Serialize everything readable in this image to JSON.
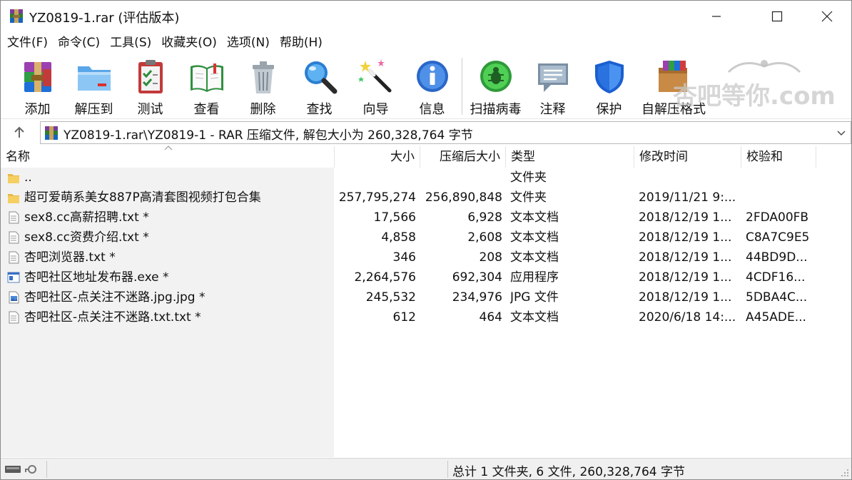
{
  "window": {
    "title": "YZ0819-1.rar (评估版本)"
  },
  "menu": [
    "文件(F)",
    "命令(C)",
    "工具(S)",
    "收藏夹(O)",
    "选项(N)",
    "帮助(H)"
  ],
  "toolbar": {
    "add": "添加",
    "extract": "解压到",
    "test": "测试",
    "view": "查看",
    "delete": "删除",
    "find": "查找",
    "wizard": "向导",
    "info": "信息",
    "virusscan": "扫描病毒",
    "comment": "注释",
    "protect": "保护",
    "sfx": "自解压格式"
  },
  "watermark": "杏吧等你.com",
  "address": {
    "path": "YZ0819-1.rar\\YZ0819-1 - RAR 压缩文件, 解包大小为 260,328,764 字节"
  },
  "columns": {
    "name": "名称",
    "size": "大小",
    "packed": "压缩后大小",
    "type": "类型",
    "modified": "修改时间",
    "crc": "校验和"
  },
  "files": [
    {
      "icon": "folder-up-icon",
      "name": "..",
      "size": "",
      "packed": "",
      "type": "文件夹",
      "modified": "",
      "crc": ""
    },
    {
      "icon": "folder-icon",
      "name": "超可爱萌系美女887P高清套图视频打包合集",
      "size": "257,795,274",
      "packed": "256,890,848",
      "type": "文件夹",
      "modified": "2019/11/21 9:...",
      "crc": ""
    },
    {
      "icon": "text-file-icon",
      "name": "sex8.cc高薪招聘.txt *",
      "size": "17,566",
      "packed": "6,928",
      "type": "文本文档",
      "modified": "2018/12/19 1...",
      "crc": "2FDA00FB"
    },
    {
      "icon": "text-file-icon",
      "name": "sex8.cc资费介绍.txt *",
      "size": "4,858",
      "packed": "2,608",
      "type": "文本文档",
      "modified": "2018/12/19 1...",
      "crc": "C8A7C9E5"
    },
    {
      "icon": "text-file-icon",
      "name": "杏吧浏览器.txt *",
      "size": "346",
      "packed": "208",
      "type": "文本文档",
      "modified": "2018/12/19 1...",
      "crc": "44BD9D..."
    },
    {
      "icon": "exe-file-icon",
      "name": "杏吧社区地址发布器.exe *",
      "size": "2,264,576",
      "packed": "692,304",
      "type": "应用程序",
      "modified": "2018/12/19 1...",
      "crc": "4CDF16..."
    },
    {
      "icon": "image-file-icon",
      "name": "杏吧社区-点关注不迷路.jpg.jpg *",
      "size": "245,532",
      "packed": "234,976",
      "type": "JPG 文件",
      "modified": "2018/12/19 1...",
      "crc": "5DBA4C..."
    },
    {
      "icon": "text-file-icon",
      "name": "杏吧社区-点关注不迷路.txt.txt *",
      "size": "612",
      "packed": "464",
      "type": "文本文档",
      "modified": "2020/6/18 14:...",
      "crc": "A45ADE..."
    }
  ],
  "status": {
    "summary": "总计 1 文件夹, 6 文件, 260,328,764 字节"
  }
}
